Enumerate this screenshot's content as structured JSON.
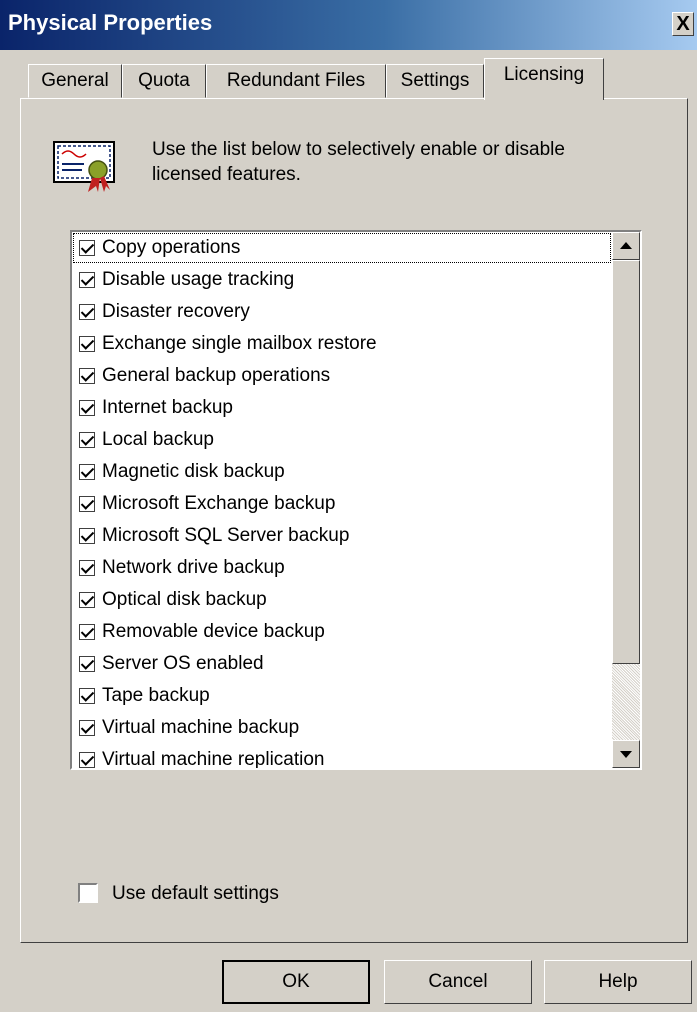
{
  "window": {
    "title": "Physical Properties",
    "close_label": "X"
  },
  "tabs": [
    {
      "label": "General"
    },
    {
      "label": "Quota"
    },
    {
      "label": "Redundant Files"
    },
    {
      "label": "Settings"
    },
    {
      "label": "Licensing",
      "active": true
    }
  ],
  "licensing": {
    "description": "Use the list below to selectively enable or disable licensed features.",
    "icon": "certificate-icon",
    "features": [
      {
        "label": "Copy operations",
        "checked": true
      },
      {
        "label": "Disable usage tracking",
        "checked": true
      },
      {
        "label": "Disaster recovery",
        "checked": true
      },
      {
        "label": "Exchange single mailbox restore",
        "checked": true
      },
      {
        "label": "General backup operations",
        "checked": true
      },
      {
        "label": "Internet backup",
        "checked": true
      },
      {
        "label": "Local backup",
        "checked": true
      },
      {
        "label": "Magnetic disk backup",
        "checked": true
      },
      {
        "label": "Microsoft Exchange backup",
        "checked": true
      },
      {
        "label": "Microsoft SQL Server backup",
        "checked": true
      },
      {
        "label": "Network drive backup",
        "checked": true
      },
      {
        "label": "Optical disk backup",
        "checked": true
      },
      {
        "label": "Removable device backup",
        "checked": true
      },
      {
        "label": "Server OS enabled",
        "checked": true
      },
      {
        "label": "Tape backup",
        "checked": true
      },
      {
        "label": "Virtual machine backup",
        "checked": true
      },
      {
        "label": "Virtual machine replication",
        "checked": true
      }
    ],
    "use_default": {
      "label": "Use default settings",
      "checked": false
    }
  },
  "buttons": {
    "ok": "OK",
    "cancel": "Cancel",
    "help": "Help"
  }
}
